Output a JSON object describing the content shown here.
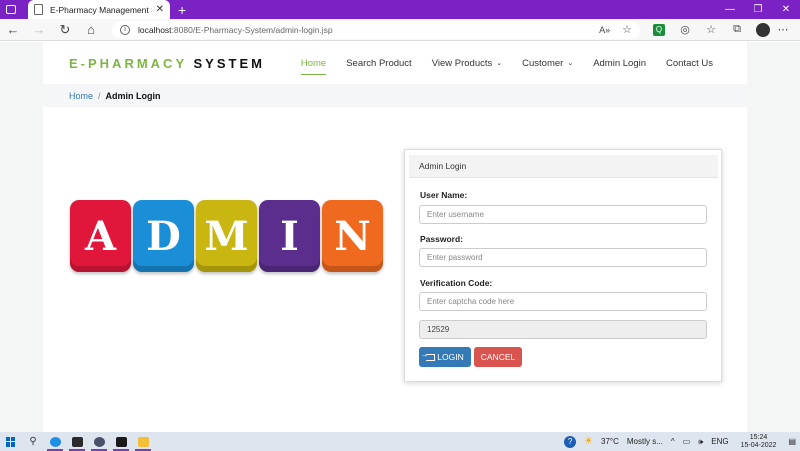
{
  "browser": {
    "tab_title": "E-Pharmacy Management Syste",
    "tab_close": "✕",
    "new_tab": "+",
    "url_host": "localhost",
    "url_path": ":8080/E-Pharmacy-System/admin-login.jsp",
    "window_controls": [
      "—",
      "❐",
      "✕"
    ]
  },
  "site": {
    "brand_part1": "E-PHARMACY",
    "brand_part2": "SYSTEM",
    "nav": {
      "home": "Home",
      "search": "Search Product",
      "view_products": "View Products",
      "customer": "Customer",
      "admin_login": "Admin Login",
      "contact": "Contact Us"
    },
    "breadcrumb": {
      "home": "Home",
      "separator": "/",
      "current": "Admin Login"
    }
  },
  "logo": {
    "letters": [
      "A",
      "D",
      "M",
      "I",
      "N"
    ],
    "colors": [
      "#e0173a",
      "#1a8ed6",
      "#c9b611",
      "#5b2e8e",
      "#ef6a1f"
    ]
  },
  "login": {
    "panel_title": "Admin Login",
    "username_label": "User Name:",
    "username_placeholder": "Enter username",
    "password_label": "Password:",
    "password_placeholder": "Enter password",
    "captcha_label": "Verification Code:",
    "captcha_placeholder": "Enter captcha code here",
    "captcha_value": "12529",
    "login_button": "LOGIN",
    "cancel_button": "CANCEL"
  },
  "taskbar": {
    "weather": "37°C",
    "weather_text": "Mostly s...",
    "language": "ENG",
    "time": "15:24",
    "date": "15-04-2022"
  }
}
